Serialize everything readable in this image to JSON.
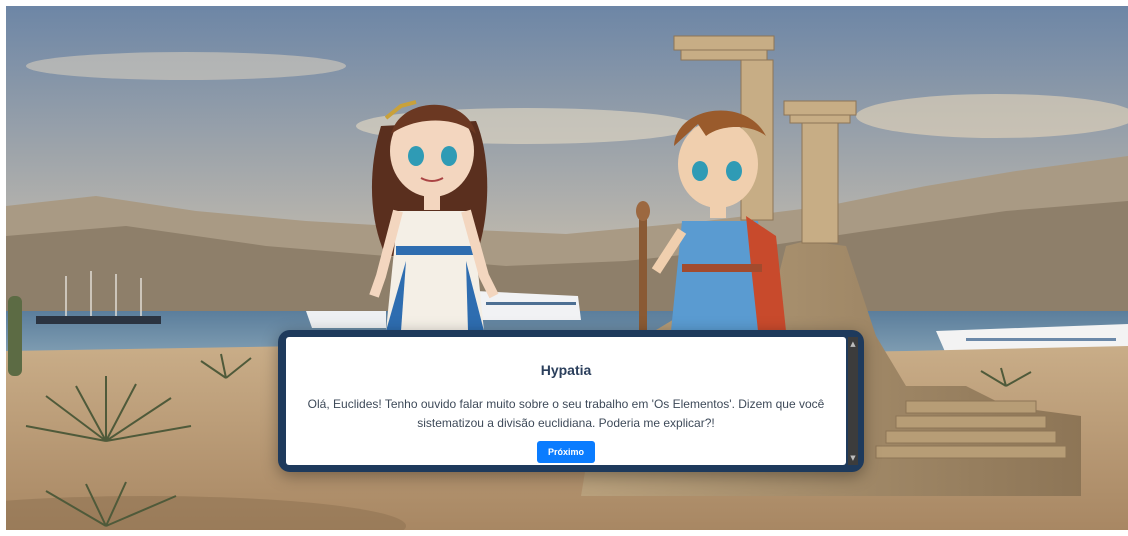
{
  "dialog": {
    "speaker": "Hypatia",
    "text": "Olá, Euclides! Tenho ouvido falar muito sobre o seu trabalho em 'Os Elementos'. Dizem que você sistematizou a divisão euclidiana. Poderia me explicar?!",
    "next_button": "Próximo"
  },
  "scene": {
    "characters": [
      "hypatia",
      "euclides"
    ],
    "setting": "ancient-coast-with-ruins",
    "colors": {
      "dialog_border": "#1e3a5c",
      "button": "#0a7cff",
      "speaker_text": "#2b3f5c"
    }
  },
  "icons": {
    "scroll_up": "scroll-up-arrow-icon",
    "scroll_down": "scroll-down-arrow-icon"
  }
}
